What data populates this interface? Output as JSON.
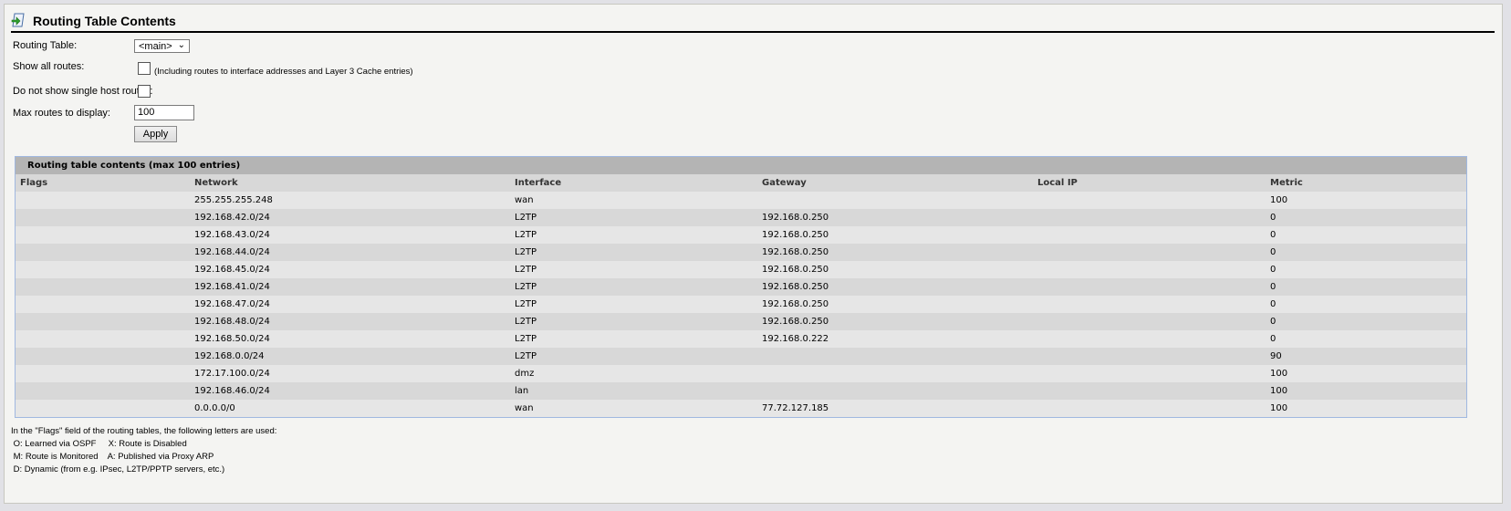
{
  "page": {
    "title": "Routing Table Contents",
    "icon": "page-arrow-icon"
  },
  "form": {
    "routing_table_label": "Routing Table:",
    "routing_table_value": "<main>",
    "show_all_label": "Show all routes:",
    "show_all_note": "(Including routes to interface addresses and Layer 3 Cache entries)",
    "show_all_checked": false,
    "no_single_host_label": "Do not show single host routes:",
    "no_single_host_checked": false,
    "max_routes_label": "Max routes to display:",
    "max_routes_value": "100",
    "apply_label": "Apply"
  },
  "table": {
    "title": "Routing table contents (max 100 entries)",
    "columns": [
      "Flags",
      "Network",
      "Interface",
      "Gateway",
      "Local IP",
      "Metric"
    ],
    "rows": [
      [
        "",
        "255.255.255.248",
        "wan",
        "",
        "",
        "100"
      ],
      [
        "",
        "192.168.42.0/24",
        "L2TP",
        "192.168.0.250",
        "",
        "0"
      ],
      [
        "",
        "192.168.43.0/24",
        "L2TP",
        "192.168.0.250",
        "",
        "0"
      ],
      [
        "",
        "192.168.44.0/24",
        "L2TP",
        "192.168.0.250",
        "",
        "0"
      ],
      [
        "",
        "192.168.45.0/24",
        "L2TP",
        "192.168.0.250",
        "",
        "0"
      ],
      [
        "",
        "192.168.41.0/24",
        "L2TP",
        "192.168.0.250",
        "",
        "0"
      ],
      [
        "",
        "192.168.47.0/24",
        "L2TP",
        "192.168.0.250",
        "",
        "0"
      ],
      [
        "",
        "192.168.48.0/24",
        "L2TP",
        "192.168.0.250",
        "",
        "0"
      ],
      [
        "",
        "192.168.50.0/24",
        "L2TP",
        "192.168.0.222",
        "",
        "0"
      ],
      [
        "",
        "192.168.0.0/24",
        "L2TP",
        "",
        "",
        "90"
      ],
      [
        "",
        "172.17.100.0/24",
        "dmz",
        "",
        "",
        "100"
      ],
      [
        "",
        "192.168.46.0/24",
        "lan",
        "",
        "",
        "100"
      ],
      [
        "",
        "0.0.0.0/0",
        "wan",
        "77.72.127.185",
        "",
        "100"
      ]
    ]
  },
  "legend": {
    "intro": "In the \"Flags\" field of the routing tables, the following letters are used:",
    "lines": [
      " O: Learned via OSPF     X: Route is Disabled",
      " M: Route is Monitored    A: Published via Proxy ARP",
      " D: Dynamic (from e.g. IPsec, L2TP/PPTP servers, etc.)"
    ]
  }
}
